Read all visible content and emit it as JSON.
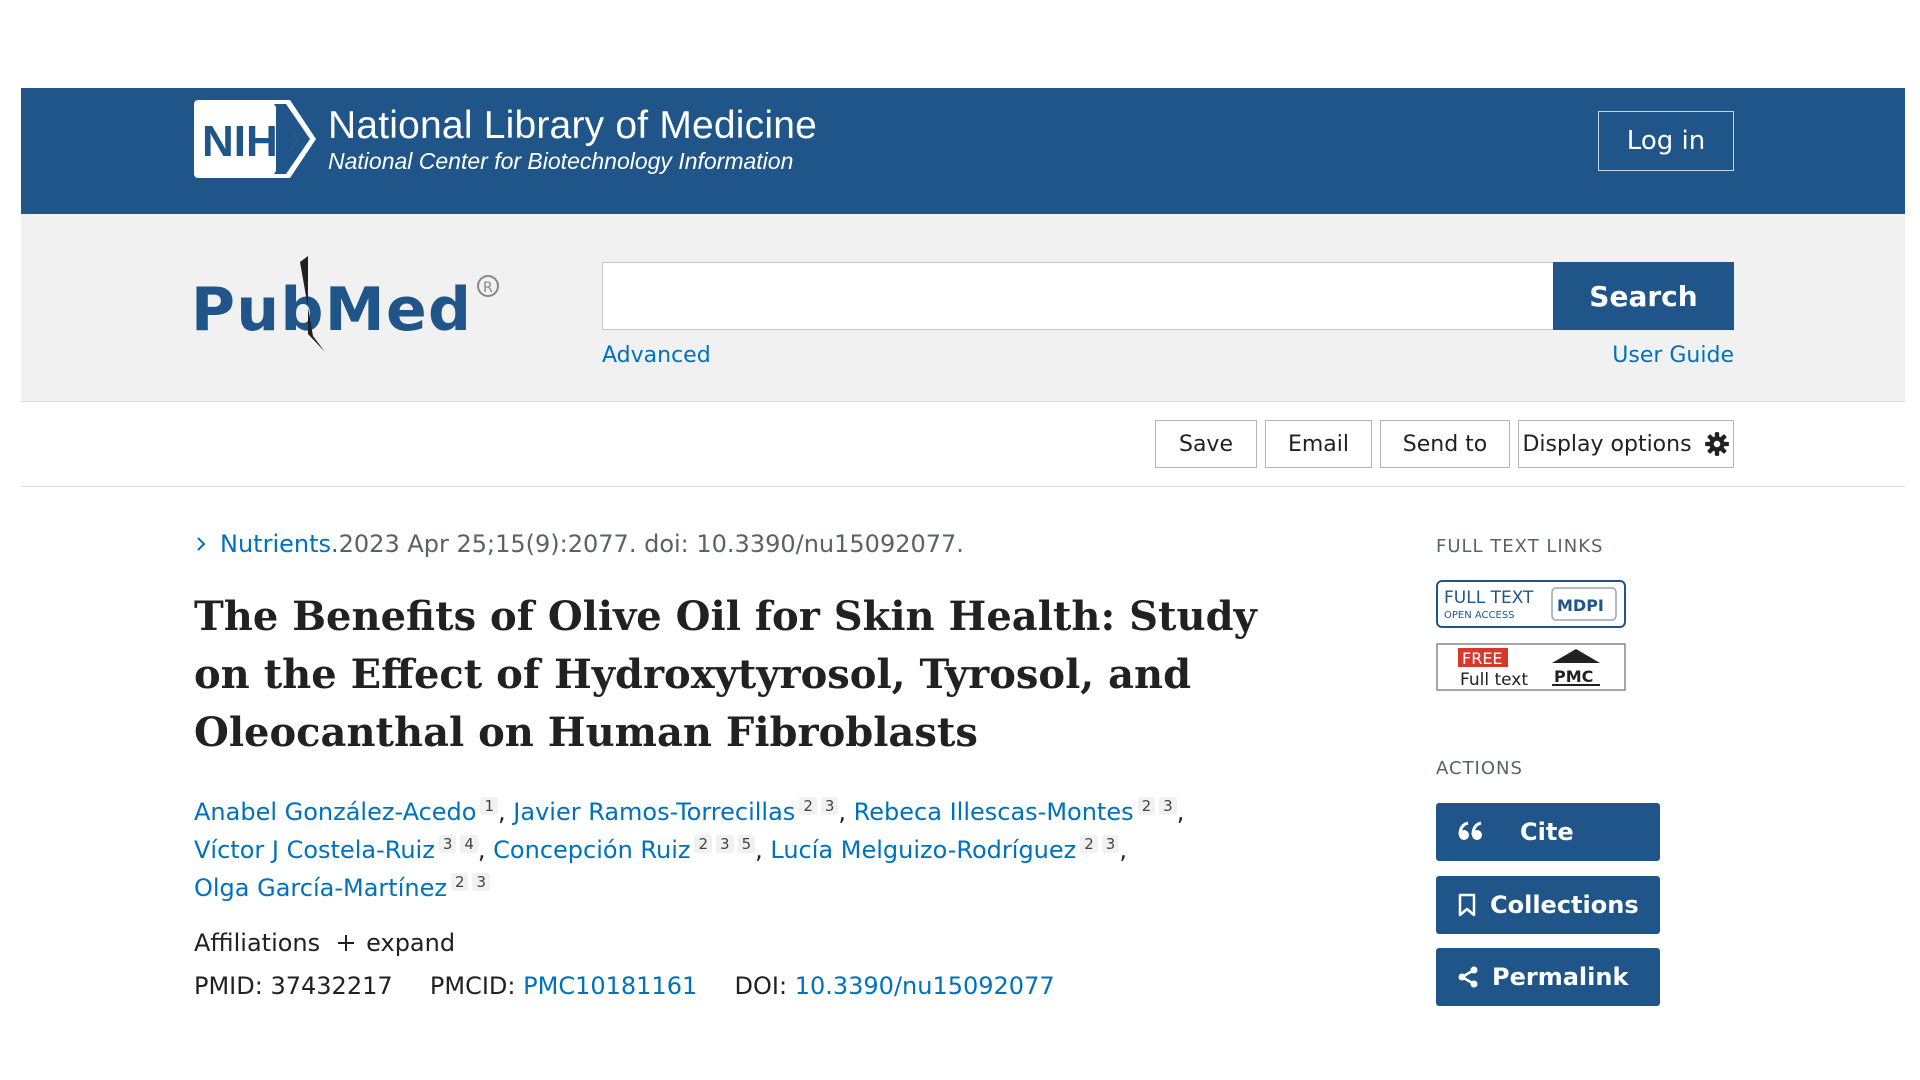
{
  "header": {
    "nih_logo_text": "NIH",
    "org_name": "National Library of Medicine",
    "org_subtitle": "National Center for Biotechnology Information",
    "login_label": "Log in",
    "brand_color": "#20558a"
  },
  "search": {
    "logo_text": "PubMed",
    "query": "",
    "button_label": "Search",
    "advanced_label": "Advanced",
    "user_guide_label": "User Guide"
  },
  "toolbar": {
    "save_label": "Save",
    "email_label": "Email",
    "send_to_label": "Send to",
    "display_options_label": "Display options"
  },
  "article": {
    "journal": "Nutrients.",
    "citation_rest": " 2023 Apr 25;15(9):2077. doi: 10.3390/nu15092077.",
    "title": "The Benefits of Olive Oil for Skin Health: Study on the Effect of Hydroxytyrosol, Tyrosol, and Oleocanthal on Human Fibroblasts",
    "authors": [
      {
        "name": "Anabel González-Acedo",
        "affils": [
          "1"
        ]
      },
      {
        "name": "Javier Ramos-Torrecillas",
        "affils": [
          "2",
          "3"
        ]
      },
      {
        "name": "Rebeca Illescas-Montes",
        "affils": [
          "2",
          "3"
        ]
      },
      {
        "name": "Víctor J Costela-Ruiz",
        "affils": [
          "3",
          "4"
        ]
      },
      {
        "name": "Concepción Ruiz",
        "affils": [
          "2",
          "3",
          "5"
        ]
      },
      {
        "name": "Lucía Melguizo-Rodríguez",
        "affils": [
          "2",
          "3"
        ]
      },
      {
        "name": "Olga García-Martínez",
        "affils": [
          "2",
          "3"
        ]
      }
    ],
    "separator": ", ",
    "trailing_comma": ",",
    "affiliations_label": "Affiliations",
    "expand_label": "expand",
    "pmid_label": "PMID:",
    "pmid_value": "37432217",
    "pmcid_label": "PMCID:",
    "pmcid_value": "PMC10181161",
    "doi_label": "DOI:",
    "doi_value": "10.3390/nu15092077"
  },
  "sidebar": {
    "full_text_heading": "FULL TEXT LINKS",
    "mdpi_badge": {
      "line1": "FULL TEXT",
      "line2": "OPEN ACCESS",
      "publisher": "MDPI"
    },
    "pmc_badge": {
      "tag": "FREE",
      "line2": "Full text",
      "publisher": "PMC"
    },
    "actions_heading": "ACTIONS",
    "cite_label": "Cite",
    "collections_label": "Collections",
    "permalink_label": "Permalink"
  }
}
